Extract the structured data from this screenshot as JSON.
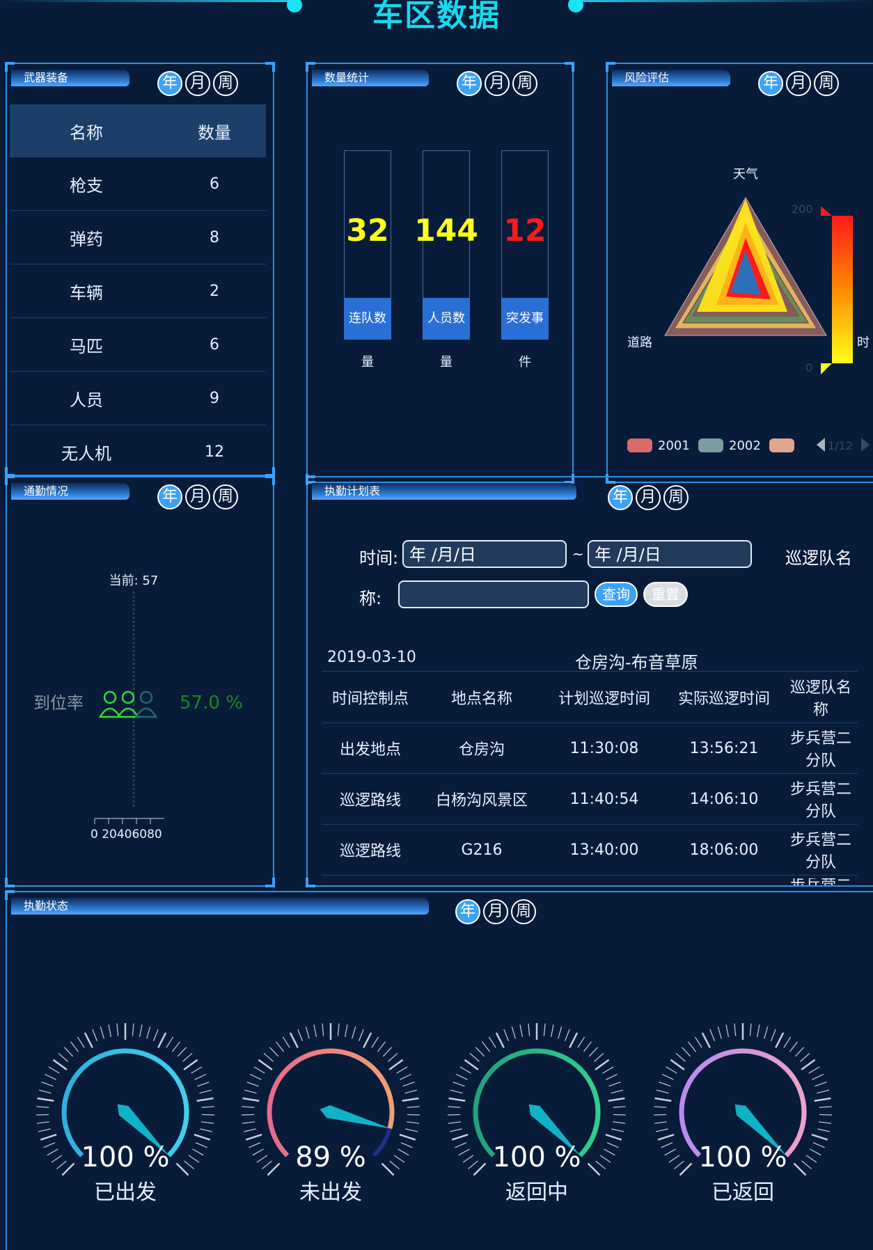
{
  "page": {
    "title": "车区数据"
  },
  "periods": [
    "年",
    "月",
    "周"
  ],
  "weapons": {
    "title": "武器装备",
    "columns": [
      "名称",
      "数量"
    ],
    "rows": [
      {
        "name": "枪支",
        "count": "6"
      },
      {
        "name": "弹药",
        "count": "8"
      },
      {
        "name": "车辆",
        "count": "2"
      },
      {
        "name": "马匹",
        "count": "6"
      },
      {
        "name": "人员",
        "count": "9"
      },
      {
        "name": "无人机",
        "count": "12"
      }
    ]
  },
  "stats": {
    "title": "数量统计",
    "items": [
      {
        "value": "32",
        "label_top": "连队数",
        "label_bottom": "量",
        "color": "#ffff1a"
      },
      {
        "value": "144",
        "label_top": "人员数",
        "label_bottom": "量",
        "color": "#ffff1a"
      },
      {
        "value": "12",
        "label_top": "突发事",
        "label_bottom": "件",
        "color": "#ff1a1a"
      }
    ]
  },
  "risk": {
    "title": "风险评估",
    "indicators": [
      "天气",
      "道路",
      "时"
    ],
    "scale_max": "200",
    "scale_min": "0",
    "legend": [
      "2001",
      "2002"
    ],
    "pager": "1/12",
    "legend_colors": [
      "#d66b6b",
      "#7c9ea0",
      "#e0a58c"
    ]
  },
  "attendance": {
    "title": "通勤情况",
    "current": "当前: 57",
    "label": "到位率",
    "percent_text": "57.0 %",
    "rate": 0.57,
    "axis_ticks": "0 20406080"
  },
  "plan": {
    "title": "执勤计划表",
    "time_label": "时间:",
    "date_from": "年 /月/日",
    "tilde": "~",
    "date_to": "年 /月/日",
    "team_label_1": "巡逻队名",
    "team_label_2": "称:",
    "query": "查询",
    "reset": "重置",
    "date": "2019-03-10",
    "route": "仓房沟-布音草原",
    "columns": [
      "时间控制点",
      "地点名称",
      "计划巡逻时间",
      "实际巡逻时间",
      "巡逻队名称"
    ],
    "rows": [
      {
        "point": "出发地点",
        "place": "仓房沟",
        "plan": "11:30:08",
        "actual": "13:56:21",
        "team": "步兵营二分队"
      },
      {
        "point": "巡逻路线",
        "place": "白杨沟风景区",
        "plan": "11:40:54",
        "actual": "14:06:10",
        "team": "步兵营二分队"
      },
      {
        "point": "巡逻路线",
        "place": "G216",
        "plan": "13:40:00",
        "actual": "18:06:00",
        "team": "步兵营二分队"
      }
    ],
    "partial_row_team": "步兵营二"
  },
  "status": {
    "title": "执勤状态",
    "gauges": [
      {
        "percent": 100,
        "text": "100 %",
        "name": "已出发",
        "color_a": "#2fb0e0",
        "color_b": "#3fd0f0"
      },
      {
        "percent": 89,
        "text": "89 %",
        "name": "未出发",
        "color_a": "#e86a8a",
        "color_b": "#f0a070"
      },
      {
        "percent": 100,
        "text": "100 %",
        "name": "返回中",
        "color_a": "#1fa37a",
        "color_b": "#2fd08a"
      },
      {
        "percent": 100,
        "text": "100 %",
        "name": "已返回",
        "color_a": "#b88af0",
        "color_b": "#f0a0c8"
      }
    ]
  }
}
